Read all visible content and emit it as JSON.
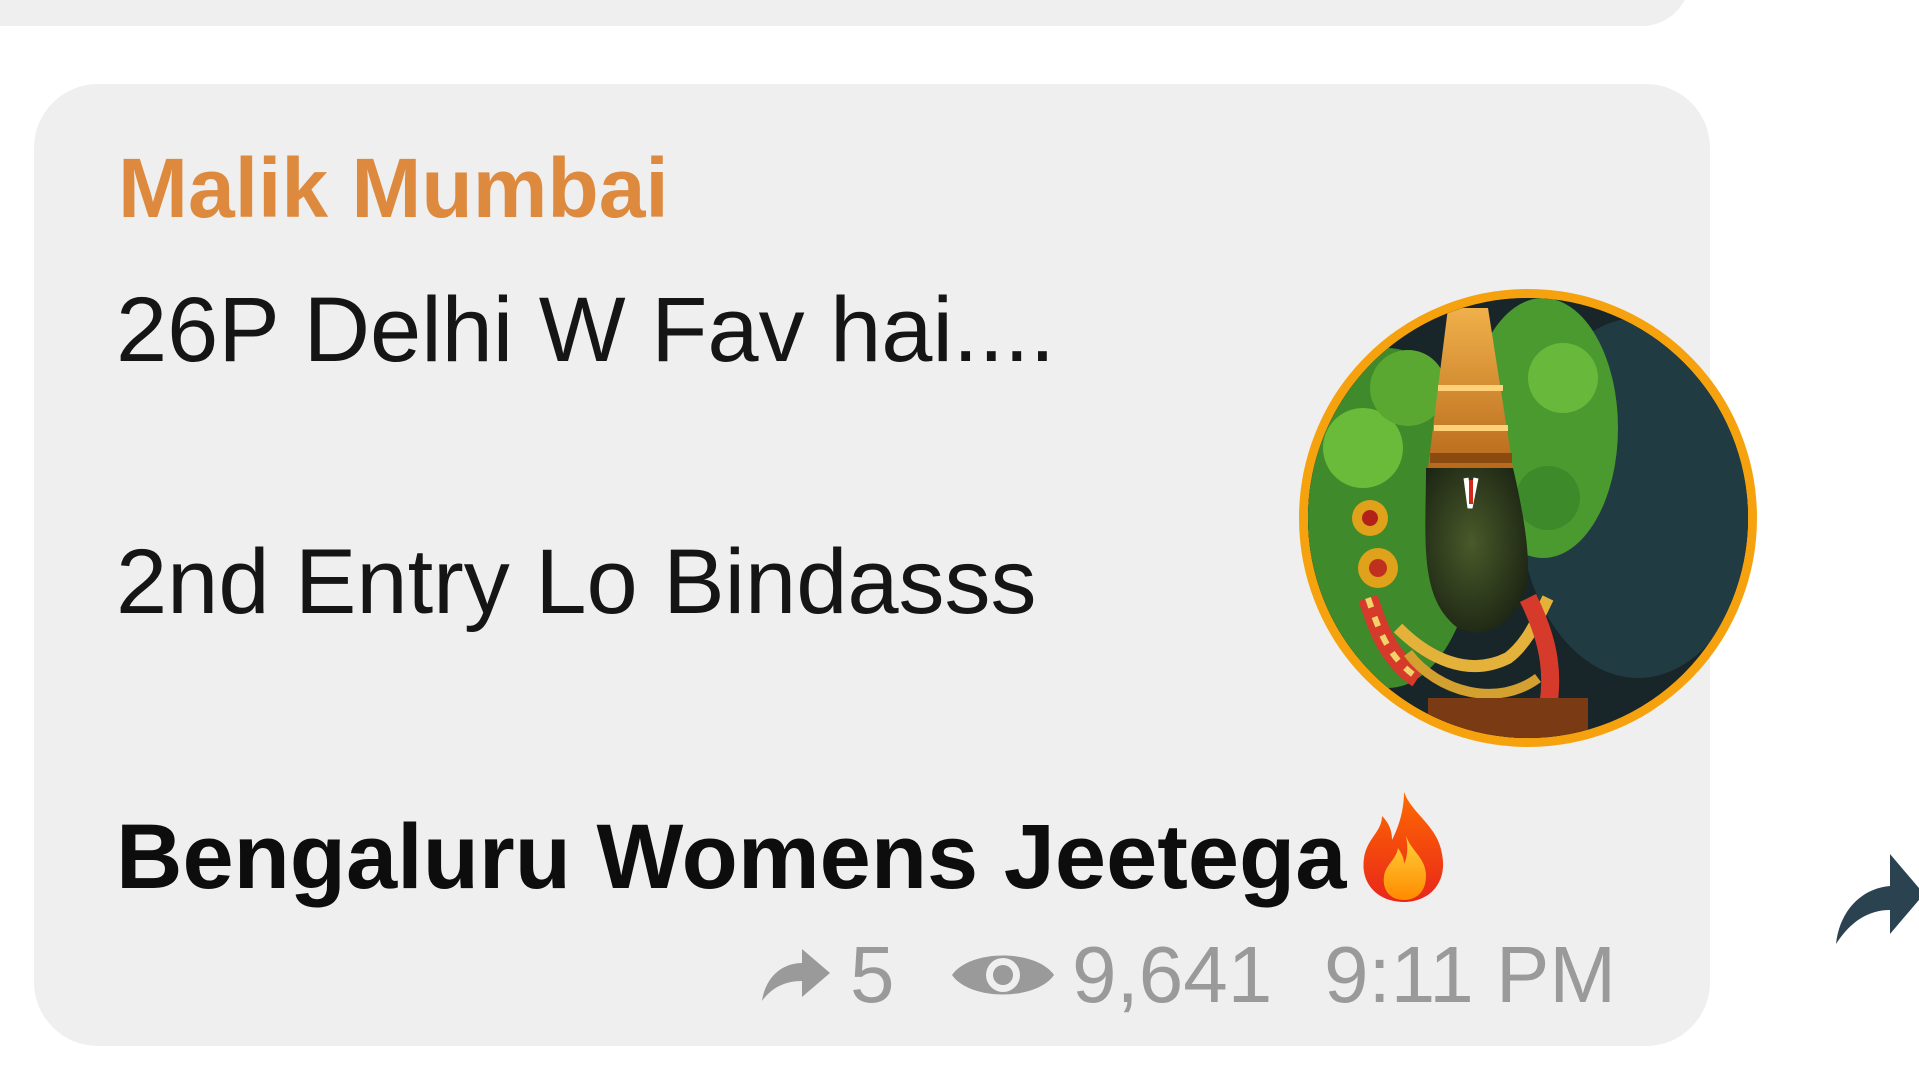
{
  "message": {
    "sender": "Malik Mumbai",
    "lines": [
      "26P Delhi W Fav hai....",
      "2nd Entry Lo Bindasss",
      "Bengaluru Womens Jeetega"
    ],
    "emoji": "fire-icon",
    "forwards": "5",
    "views": "9,641",
    "time": "9:11 PM"
  },
  "colors": {
    "bubble": "#efefef",
    "sender": "#dd8a3e",
    "meta": "#9a9a9a",
    "avatar_ring": "#f5a20e",
    "share_button": "#2b4250"
  },
  "icons": {
    "forward": "forward-arrow-icon",
    "views": "eye-icon",
    "share": "share-arrow-icon",
    "avatar": "channel-avatar"
  }
}
